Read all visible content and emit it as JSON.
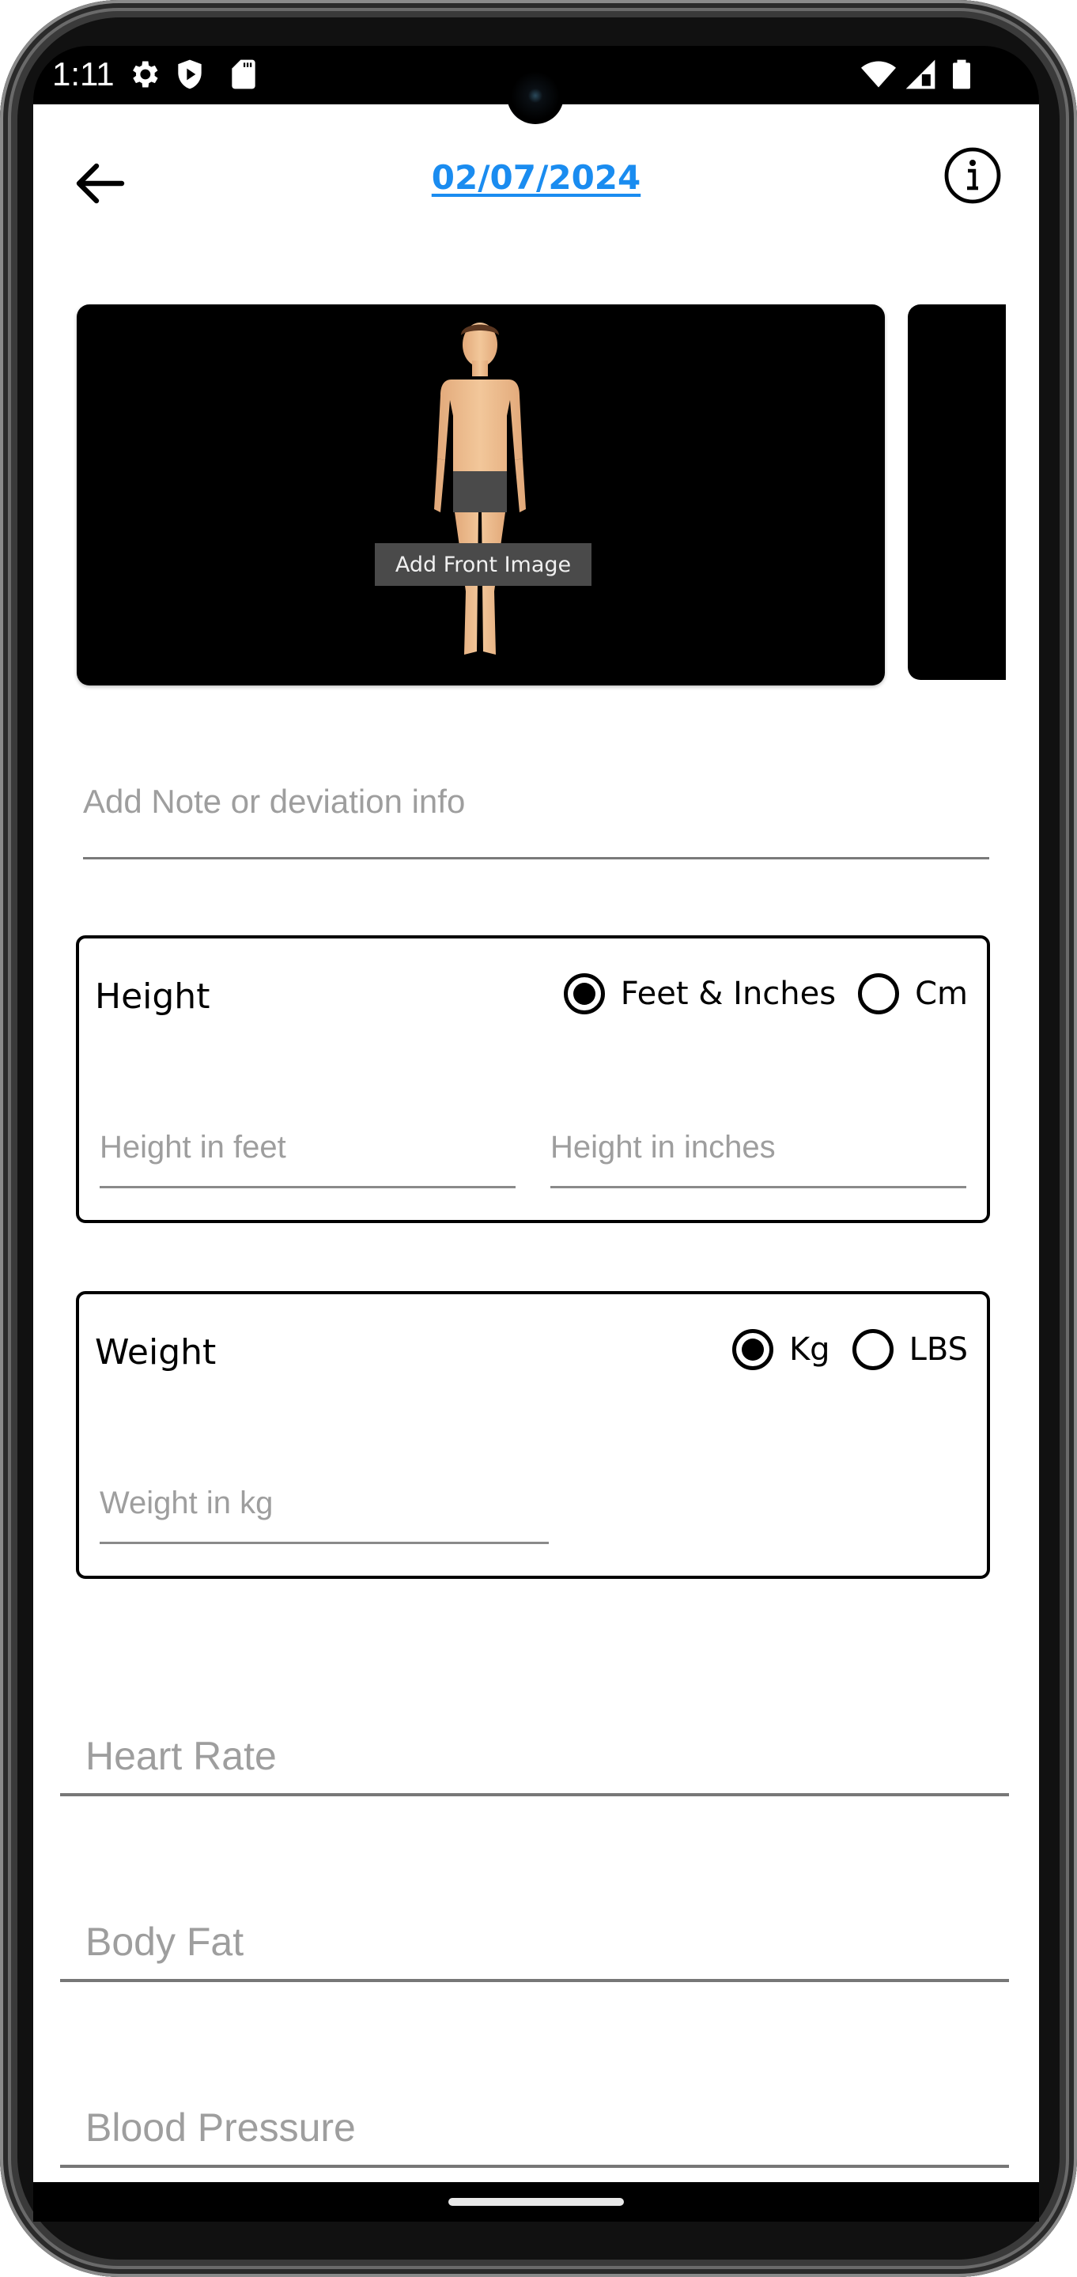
{
  "status_bar": {
    "time": "1:11",
    "left_icons": [
      "settings-icon",
      "play-protect-icon",
      "sd-card-icon"
    ],
    "right_icons": [
      "wifi-icon",
      "cellular-signal-icon",
      "battery-icon"
    ]
  },
  "header": {
    "back_icon": "arrow-left-icon",
    "title": "02/07/2024",
    "info_icon": "info-circle-icon",
    "title_color": "#1a8cf0"
  },
  "images": {
    "front_card_label": "Add Front Image"
  },
  "note": {
    "placeholder": "Add Note or deviation info",
    "value": ""
  },
  "height": {
    "label": "Height",
    "options": [
      {
        "label": "Feet & Inches",
        "selected": true
      },
      {
        "label": "Cm",
        "selected": false
      }
    ],
    "feet_placeholder": "Height in feet",
    "inches_placeholder": "Height in inches"
  },
  "weight": {
    "label": "Weight",
    "options": [
      {
        "label": "Kg",
        "selected": true
      },
      {
        "label": "LBS",
        "selected": false
      }
    ],
    "placeholder": "Weight in kg"
  },
  "vitals": [
    {
      "placeholder": "Heart Rate",
      "value": ""
    },
    {
      "placeholder": "Body Fat",
      "value": ""
    },
    {
      "placeholder": "Blood Pressure",
      "value": ""
    }
  ]
}
